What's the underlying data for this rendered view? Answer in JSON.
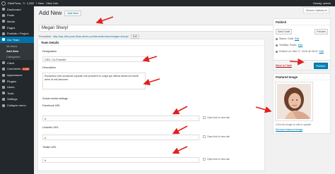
{
  "adminbar": {
    "site": "DiboPress",
    "updates": "3",
    "comments": "1,265",
    "new": "+ New",
    "view": "View Link",
    "greeting": "Howdy, admin"
  },
  "sidebar": {
    "items": [
      {
        "label": "Dashboard"
      },
      {
        "label": "Posts"
      },
      {
        "label": "Media"
      },
      {
        "label": "Pages"
      },
      {
        "label": "Portfolio / Project"
      },
      {
        "label": "Our Team"
      }
    ],
    "submenu": [
      "All Items",
      "Add New",
      "Categories"
    ],
    "items2": [
      {
        "label": "Client"
      },
      {
        "label": "Comments",
        "badge": "1,265"
      },
      {
        "label": "Appearance"
      },
      {
        "label": "Plugins"
      },
      {
        "label": "Users"
      },
      {
        "label": "Tools"
      },
      {
        "label": "Settings"
      },
      {
        "label": "Collapse menu"
      }
    ]
  },
  "header": {
    "title": "Add New",
    "add_new": "Add New",
    "screen_options": "Screen Options ▾"
  },
  "post": {
    "title": "Megan Sheryl",
    "permalink_label": "Permalink:",
    "permalink_url": "http://wp-elfe.yourl.itl/an-dives-ux/elements-team/megan-sheryl/",
    "ok_label": "Edit"
  },
  "team_details": {
    "heading": "Team Details",
    "designation_label": "Designation",
    "designation_value": "CEO, Co-Founder",
    "description_label": "Description",
    "description_value": "Excepteur sint occaecat cupidat non proident in culpa qui officia deserunt mollit anim id est laborum",
    "social_label": "Social media settings",
    "facebook_label": "Facebook URL",
    "facebook_value": "#",
    "linkedin_label": "LinkedIn URL",
    "linkedin_value": "#",
    "twitter_label": "Twitter URL",
    "twitter_value": "#",
    "new_tab_label": "Open link in new tab"
  },
  "publish": {
    "heading": "Publish",
    "save_draft": "Save Draft",
    "preview": "Preview",
    "status_label": "Status:",
    "status_value": "Draft",
    "visibility_label": "Visibility:",
    "visibility_value": "Public",
    "publish_label": "Publish on: Mar 17, 2016 @ 06:02",
    "edit": "Edit",
    "trash": "Move to Trash",
    "publish_btn": "Publish"
  },
  "featured": {
    "heading": "Featured Image",
    "note": "Click the image to edit or update",
    "remove": "Remove featured image"
  },
  "colors": {
    "accent": "#0073aa",
    "arrow": "#e02020",
    "admin_bg": "#23282d"
  }
}
